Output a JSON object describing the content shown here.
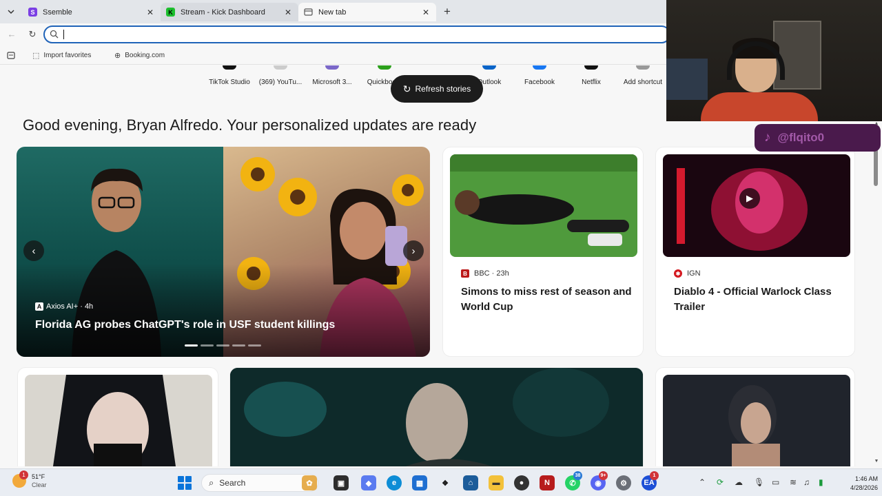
{
  "tabs": [
    {
      "title": "Ssemble",
      "favicon_color": "#7b3fe4"
    },
    {
      "title": "Stream - Kick Dashboard",
      "favicon_color": "#1dbf2e"
    },
    {
      "title": "New tab",
      "favicon_color": "#666666"
    }
  ],
  "address": {
    "value": "",
    "placeholder": ""
  },
  "favorites": [
    {
      "label": "Import favorites",
      "icon": "import-icon"
    },
    {
      "label": "Booking.com",
      "icon": "globe-icon"
    }
  ],
  "shortcuts": [
    {
      "label": "TikTok Studio",
      "color": "#111111"
    },
    {
      "label": "(369) YouTu...",
      "color": "#cccccc"
    },
    {
      "label": "Microsoft 3...",
      "color": "#7b68c9"
    },
    {
      "label": "Quickboo...",
      "color": "#2ca01c"
    },
    {
      "label": "Outlook",
      "color": "#0a64c8"
    },
    {
      "label": "Facebook",
      "color": "#1877f2"
    },
    {
      "label": "Netflix",
      "color": "#111111"
    },
    {
      "label": "Add shortcut",
      "color": "#999999"
    }
  ],
  "refresh_label": "Refresh stories",
  "greeting": "Good evening, Bryan Alfredo. Your personalized updates are ready",
  "hero": {
    "source": "Axios AI+",
    "time": "4h",
    "source_line": "Axios AI+ · 4h",
    "headline": "Florida AG probes ChatGPT's role in USF student killings",
    "slide_count": 5,
    "active_slide": 0
  },
  "news": [
    {
      "source_line": "BBC · 23h",
      "title": "Simons to miss rest of season and World Cup",
      "logo_color": "#bb1919"
    },
    {
      "source_line": "IGN",
      "title": "Diablo 4 - Official Warlock Class Trailer",
      "logo_color": "#d4181f"
    }
  ],
  "overlay": {
    "tiktok_handle": "@flqito0"
  },
  "taskbar": {
    "weather_temp": "51°F",
    "weather_desc": "Clear",
    "weather_badge": "1",
    "search_label": "Search",
    "time": "1:46 AM",
    "date": "4/28/2026",
    "badges": {
      "whatsapp": "38",
      "discord": "9+",
      "ea": "1"
    }
  }
}
